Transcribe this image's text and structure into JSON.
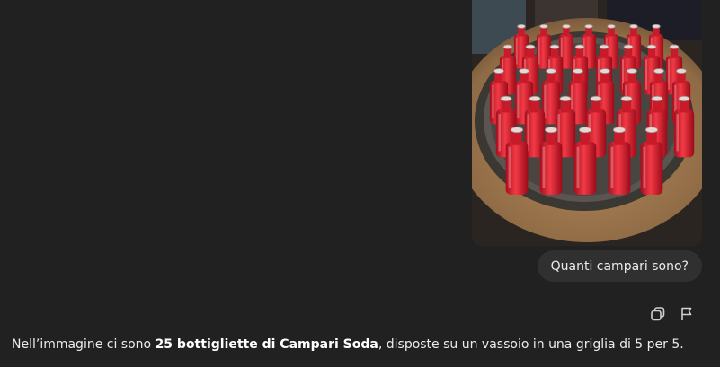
{
  "user_message": {
    "text": "Quanti campari sono?"
  },
  "actions": {
    "copy_icon": "copy-icon",
    "flag_icon": "flag-icon"
  },
  "assistant_reply": {
    "prefix": "Nell’immagine ci sono ",
    "bold": "25 bottigliette di Campari Soda",
    "suffix": ", disposte su un vassoio in una griglia di 5 per 5."
  },
  "colors": {
    "background": "#212121",
    "bubble": "#303030",
    "text": "#ececec",
    "bottle_red": "#e0172b"
  }
}
